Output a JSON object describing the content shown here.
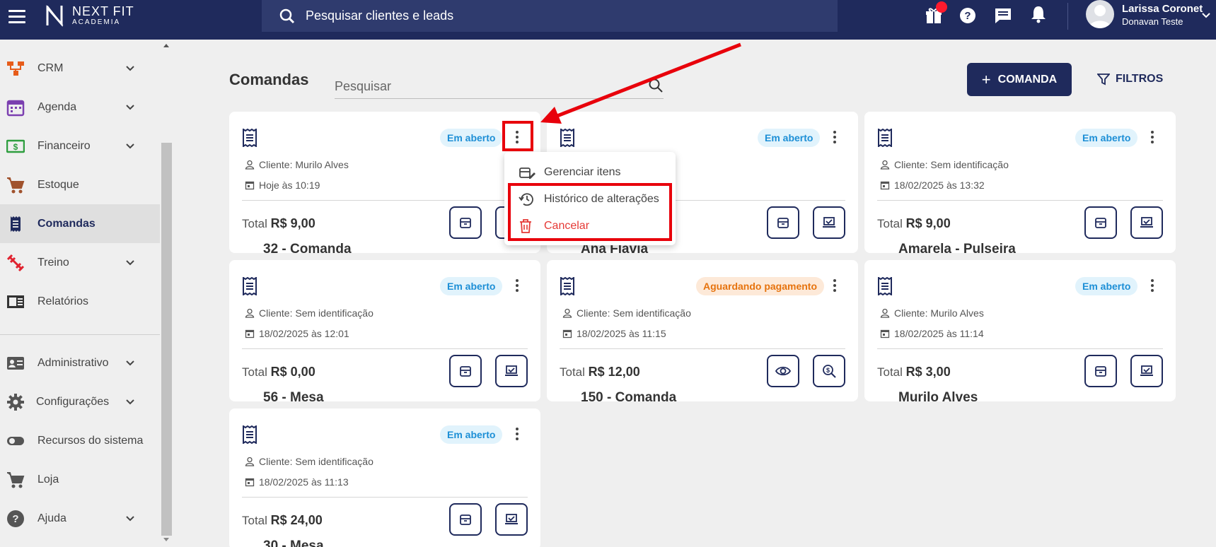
{
  "header": {
    "logo_line1": "NEXT FIT",
    "logo_line2": "ACADEMIA",
    "search_placeholder": "Pesquisar clientes e leads",
    "user_name": "Larissa Coronet",
    "user_subtitle": "Donavan Teste",
    "icons": [
      "gift-icon",
      "help-icon",
      "chat-icon",
      "bell-icon"
    ]
  },
  "sidebar": {
    "items": [
      {
        "label": "CRM",
        "icon": "crm-icon",
        "expandable": true
      },
      {
        "label": "Agenda",
        "icon": "calendar-icon",
        "expandable": true
      },
      {
        "label": "Financeiro",
        "icon": "money-icon",
        "expandable": true
      },
      {
        "label": "Estoque",
        "icon": "cart-icon",
        "expandable": false
      },
      {
        "label": "Comandas",
        "icon": "receipt-icon",
        "expandable": false,
        "active": true
      },
      {
        "label": "Treino",
        "icon": "dumbbell-icon",
        "expandable": true
      },
      {
        "label": "Relatórios",
        "icon": "report-icon",
        "expandable": false
      },
      {
        "label": "Administrativo",
        "icon": "id-card-icon",
        "expandable": true
      },
      {
        "label": "Configurações",
        "icon": "gear-icon",
        "expandable": true
      },
      {
        "label": "Recursos do sistema",
        "icon": "toggle-icon",
        "expandable": false
      },
      {
        "label": "Loja",
        "icon": "cart-icon",
        "expandable": false
      },
      {
        "label": "Ajuda",
        "icon": "help-icon",
        "expandable": true
      }
    ]
  },
  "page": {
    "title": "Comandas",
    "search_placeholder": "Pesquisar",
    "new_button": "COMANDA",
    "filters_button": "FILTROS"
  },
  "cards": [
    {
      "title": "32 - Comanda",
      "status": "Em aberto",
      "client": "Cliente: Murilo Alves",
      "date": "Hoje às 10:19",
      "total_label": "Total",
      "total": "R$ 9,00"
    },
    {
      "title": "Ana Flávia",
      "status": "Em aberto",
      "client": "",
      "date": "",
      "total_label": "",
      "total": ""
    },
    {
      "title": "Amarela - Pulseira",
      "status": "Em aberto",
      "client": "Cliente: Sem identificação",
      "date": "18/02/2025 às 13:32",
      "total_label": "Total",
      "total": "R$ 9,00"
    },
    {
      "title": "56 - Mesa",
      "status": "Em aberto",
      "client": "Cliente: Sem identificação",
      "date": "18/02/2025 às 12:01",
      "total_label": "Total",
      "total": "R$ 0,00"
    },
    {
      "title": "150 - Comanda",
      "status": "Aguardando pagamento",
      "client": "Cliente: Sem identificação",
      "date": "18/02/2025 às 11:15",
      "total_label": "Total",
      "total": "R$ 12,00"
    },
    {
      "title": "Murilo Alves",
      "status": "Em aberto",
      "client": "Cliente: Murilo Alves",
      "date": "18/02/2025 às 11:14",
      "total_label": "Total",
      "total": "R$ 3,00"
    },
    {
      "title": "30 - Mesa",
      "status": "Em aberto",
      "client": "Cliente: Sem identificação",
      "date": "18/02/2025 às 11:13",
      "total_label": "Total",
      "total": "R$ 24,00"
    }
  ],
  "context_menu": {
    "items": [
      {
        "label": "Gerenciar itens",
        "icon": "cart-edit-icon"
      },
      {
        "label": "Histórico de alterações",
        "icon": "history-icon"
      },
      {
        "label": "Cancelar",
        "icon": "trash-icon"
      }
    ]
  },
  "colors": {
    "navy": "#1f2a5c",
    "accent_red": "#e8000b",
    "open_badge": "#1d8fd6",
    "wait_badge": "#e6730e"
  }
}
